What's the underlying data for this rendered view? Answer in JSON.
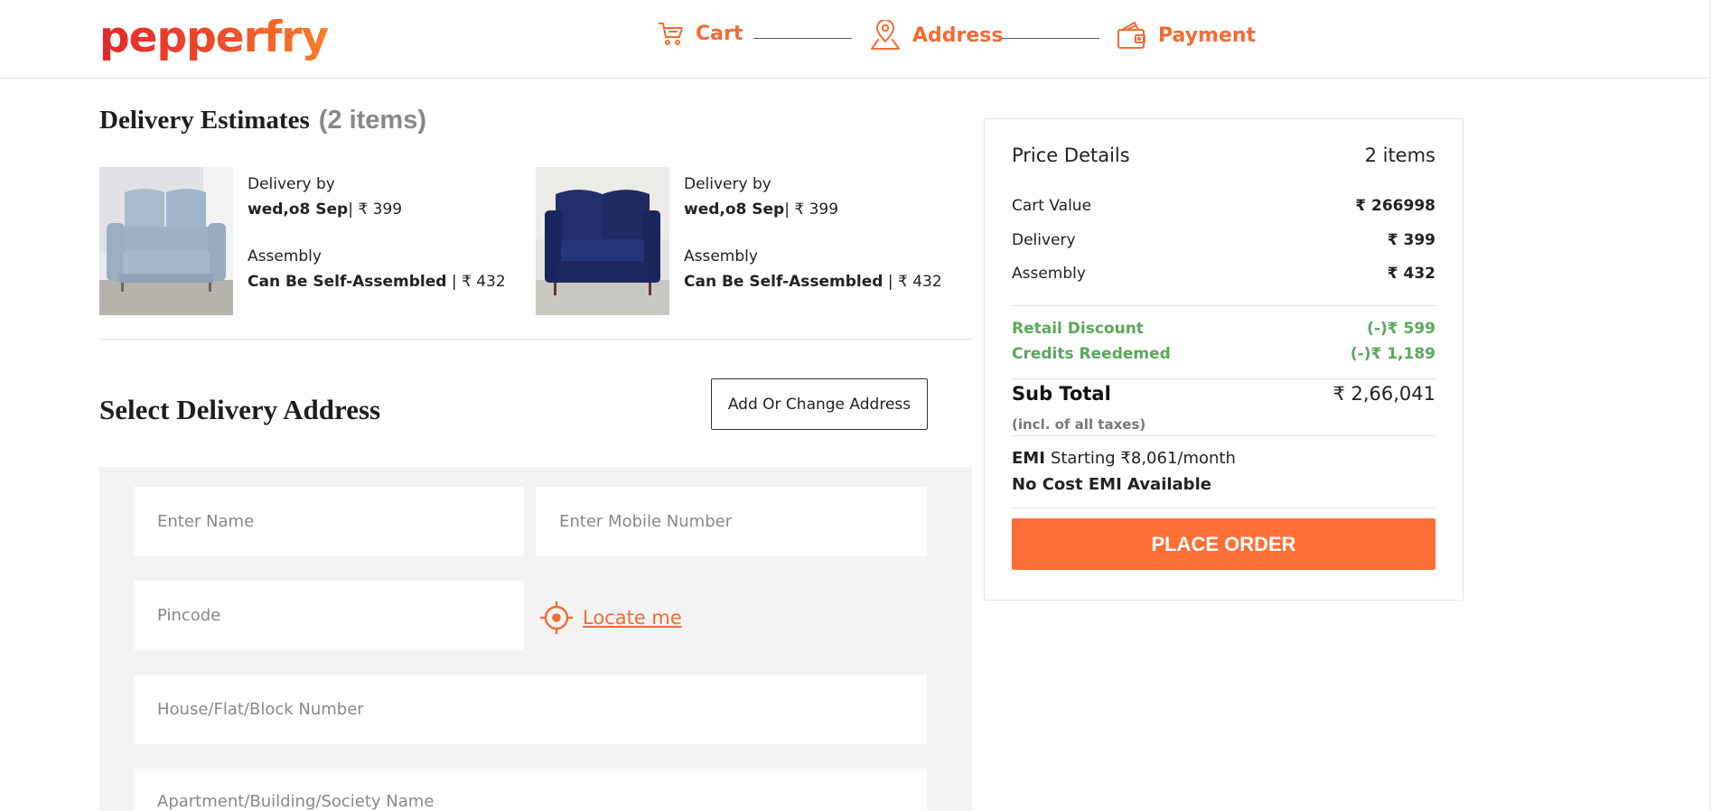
{
  "header": {
    "logo": "pepperfry",
    "steps": [
      {
        "label": "Cart",
        "icon": "cart-icon"
      },
      {
        "label": "Address",
        "icon": "location-pin-icon"
      },
      {
        "label": "Payment",
        "icon": "wallet-icon"
      }
    ]
  },
  "delivery": {
    "title": "Delivery Estimates",
    "count": "(2 items)",
    "products": [
      {
        "image": "grey-loveseat-image",
        "delivery_label": "Delivery by",
        "delivery_date": "wed,o8 Sep",
        "delivery_price": "| ₹ 399",
        "assembly_label": "Assembly",
        "assembly_type": "Can Be Self-Assembled",
        "assembly_price": " | ₹ 432"
      },
      {
        "image": "navy-armchair-image",
        "delivery_label": "Delivery by",
        "delivery_date": "wed,o8 Sep",
        "delivery_price": "| ₹ 399",
        "assembly_label": "Assembly",
        "assembly_type": "Can Be Self-Assembled",
        "assembly_price": " | ₹ 432"
      }
    ]
  },
  "address": {
    "title": "Select Delivery Address",
    "change_button": "Add Or Change Address",
    "name_placeholder": "Enter Name",
    "mobile_placeholder": "Enter Mobile Number",
    "pincode_placeholder": "Pincode",
    "locate_label": "Locate me",
    "house_placeholder": "House/Flat/Block Number",
    "apartment_placeholder": "Apartment/Building/Society Name"
  },
  "price": {
    "title": "Price Details",
    "items": "2 items",
    "cart_value_label": "Cart Value",
    "cart_value": "₹ 266998",
    "delivery_label": "Delivery",
    "delivery_value": "₹ 399",
    "assembly_label": "Assembly",
    "assembly_value": "₹ 432",
    "retail_discount_label": "Retail Discount",
    "retail_discount_value": "(-)₹ 599",
    "credits_label": "Credits Reedemed",
    "credits_value": "(-)₹ 1,189",
    "subtotal_label": "Sub Total",
    "subtotal_value": "₹ 2,66,041",
    "taxes_note": "(incl. of all taxes)",
    "emi_prefix": "EMI",
    "emi_text": "Starting ₹8,061/month",
    "no_cost_emi": "No Cost EMI Available",
    "place_order": "PLACE ORDER"
  },
  "colors": {
    "accent": "#f36b34",
    "button": "#ff6f35",
    "discount_green": "#5aa85a",
    "form_background": "#f3f3f3"
  }
}
